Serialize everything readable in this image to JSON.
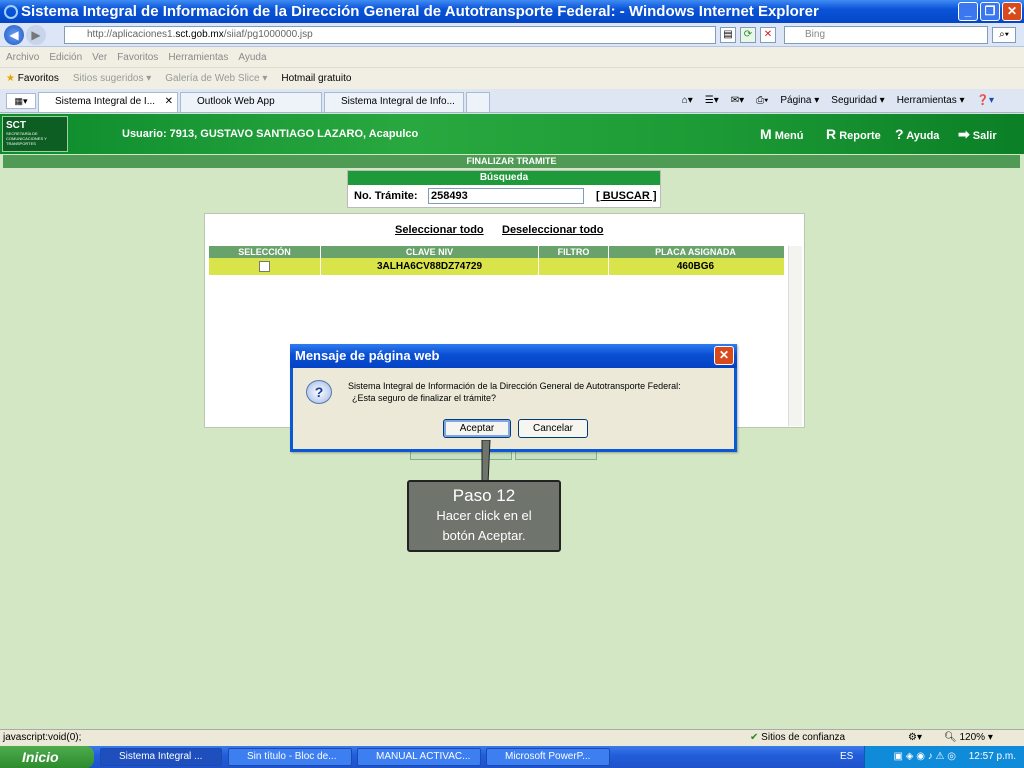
{
  "window": {
    "title": "Sistema Integral de Información de la Dirección General de Autotransporte Federal: - Windows Internet Explorer"
  },
  "browser": {
    "url_prefix": "http://aplicaciones1.",
    "url_domain": "sct.gob.mx",
    "url_suffix": "/siiaf/pg1000000.jsp",
    "search_placeholder": "Bing",
    "menu": [
      "Archivo",
      "Edición",
      "Ver",
      "Favoritos",
      "Herramientas",
      "Ayuda"
    ],
    "favorites_label": "Favoritos",
    "favorites_links": [
      "Sitios sugeridos ▾",
      "Galería de Web Slice ▾",
      "Hotmail gratuito"
    ],
    "tabs": [
      "Sistema Integral de I...",
      "Outlook Web App",
      "Sistema Integral de Info..."
    ],
    "commands": [
      "Página ▾",
      "Seguridad ▾",
      "Herramientas ▾"
    ]
  },
  "banner": {
    "logo_text": "SCT",
    "logo_sub": "SECRETARÍA DE COMUNICACIONES Y TRANSPORTES",
    "user": "Usuario: 7913, GUSTAVO SANTIAGO LAZARO, Acapulco",
    "nav": [
      "Menú",
      "Reporte",
      "Ayuda",
      "Salir"
    ]
  },
  "page": {
    "section_title": "FINALIZAR TRAMITE",
    "search_title": "Búsqueda",
    "tramite_label": "No. Trámite:",
    "tramite_value": "258493",
    "buscar_label": "[ BUSCAR ]",
    "select_all": "Seleccionar todo",
    "deselect_all": "Deseleccionar todo",
    "columns": [
      "SELECCIÓN",
      "CLAVE NIV",
      "FILTRO",
      "PLACA ASIGNADA"
    ],
    "rows": [
      {
        "clave": "3ALHA6CV88DZ74729",
        "filtro": "",
        "placa": "460BG6"
      }
    ]
  },
  "dialog": {
    "title": "Mensaje de página web",
    "line1": "Sistema Integral de Información de la Dirección General de Autotransporte Federal:",
    "line2": "¿Esta seguro de finalizar el trámite?",
    "ok": "Aceptar",
    "cancel": "Cancelar"
  },
  "callout": {
    "step": "Paso 12",
    "line1": "Hacer click en el",
    "line2": "botón Aceptar."
  },
  "status": {
    "left": "javascript:void(0);",
    "zone": "Sitios de confianza",
    "zoom": "120%"
  },
  "taskbar": {
    "start": "Inicio",
    "tasks": [
      "Sistema Integral ...",
      "Sin título - Bloc de...",
      "MANUAL ACTIVAC...",
      "Microsoft PowerP..."
    ],
    "lang": "ES",
    "clock": "12:57 p.m."
  },
  "colors": {
    "banner_green": "#1c9a35",
    "row_yellow": "#d9e44b",
    "dialog_blue": "#0a4fd3"
  }
}
